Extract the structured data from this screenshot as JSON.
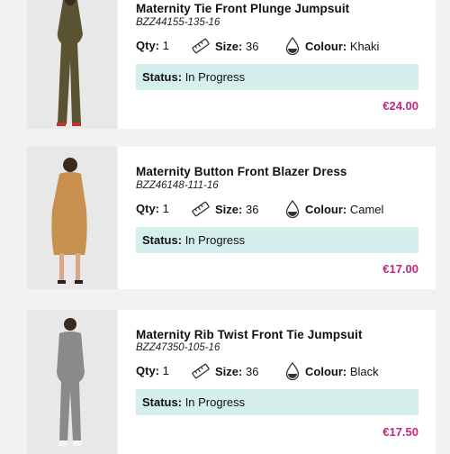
{
  "labels": {
    "qty": "Qty:",
    "size": "Size:",
    "colour": "Colour:",
    "status": "Status:"
  },
  "icons": {
    "size": "ruler-icon",
    "colour": "water-drop-icon"
  },
  "colors": {
    "price": "#c2287f",
    "status_bg": "#d5efec"
  },
  "items": [
    {
      "name": "Maternity Tie Front Plunge Jumpsuit",
      "sku": "BZZ44155-135-16",
      "qty": "1",
      "size": "36",
      "colour": "Khaki",
      "status": "In Progress",
      "price": "€24.00"
    },
    {
      "name": "Maternity Button Front Blazer Dress",
      "sku": "BZZ46148-111-16",
      "qty": "1",
      "size": "36",
      "colour": "Camel",
      "status": "In Progress",
      "price": "€17.00"
    },
    {
      "name": "Maternity Rib Twist Front Tie Jumpsuit",
      "sku": "BZZ47350-105-16",
      "qty": "1",
      "size": "36",
      "colour": "Black",
      "status": "In Progress",
      "price": "€17.50"
    }
  ]
}
